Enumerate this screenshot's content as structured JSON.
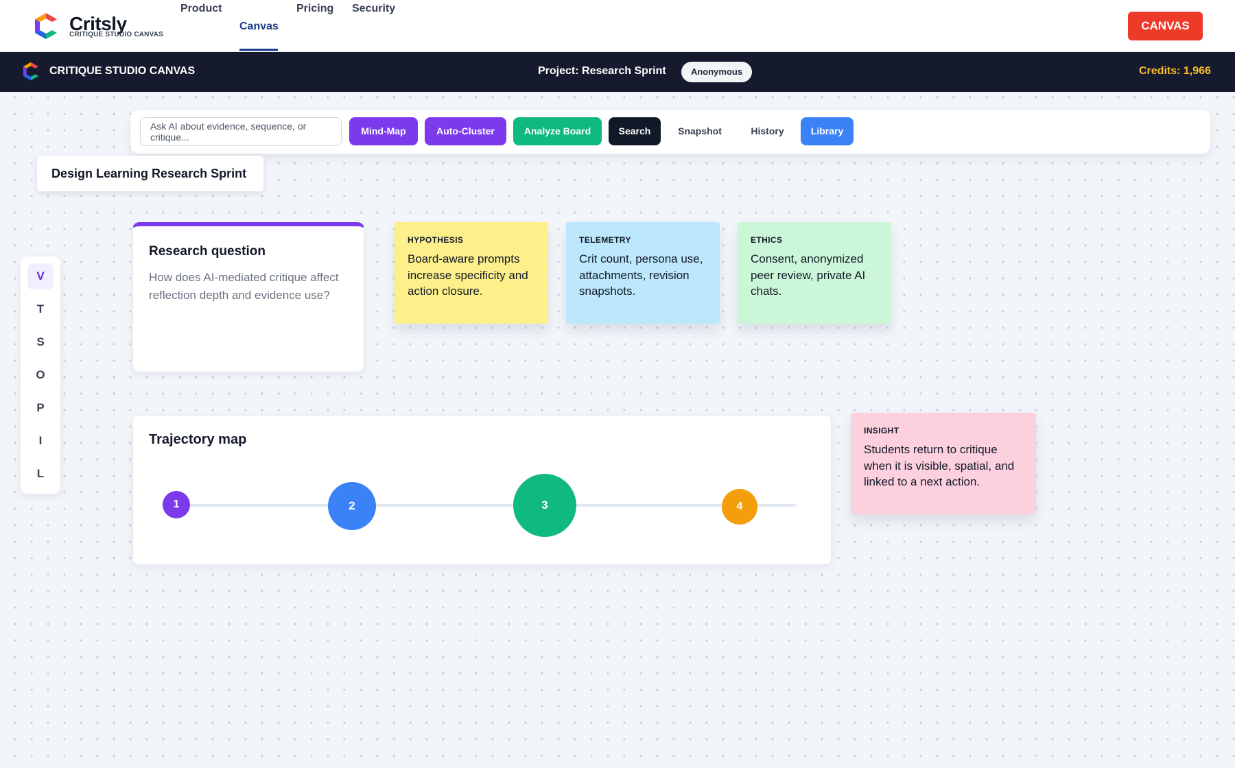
{
  "nav": {
    "brand_name": "Critsly",
    "brand_subtitle": "CRITIQUE STUDIO CANVAS",
    "links": [
      "Product",
      "Canvas",
      "Pricing",
      "Security"
    ],
    "active_link": "Canvas",
    "cta_label": "CANVAS"
  },
  "studio_bar": {
    "title": "CRITIQUE STUDIO CANVAS",
    "project": "Project: Research Sprint",
    "badge": "Anonymous",
    "credits": "Credits: 1,966"
  },
  "toolbar": {
    "ask_placeholder": "Ask AI about evidence, sequence, or critique...",
    "buttons": [
      "Mind-Map",
      "Auto-Cluster",
      "Analyze Board",
      "Search",
      "Snapshot",
      "History",
      "Library"
    ]
  },
  "board": {
    "title": "Design Learning Research Sprint"
  },
  "rail": {
    "items": [
      "V",
      "T",
      "S",
      "O",
      "P",
      "I",
      "L"
    ],
    "active": "V"
  },
  "research_card": {
    "title": "Research question",
    "body": "How does AI-mediated critique affect reflection depth and evidence use?"
  },
  "stickies": [
    {
      "label": "HYPOTHESIS",
      "text": "Board-aware prompts increase specificity and action closure.",
      "color": "#fdf08a"
    },
    {
      "label": "TELEMETRY",
      "text": "Crit count, persona use, attachments, revision snapshots.",
      "color": "#bde7fb"
    },
    {
      "label": "ETHICS",
      "text": "Consent, anonymized peer review, private AI chats.",
      "color": "#cbf7d8"
    },
    {
      "label": "INSIGHT",
      "text": "Students return to critique when it is visible, spatial, and linked to a next action.",
      "color": "#fdd0de"
    }
  ],
  "trajectory": {
    "title": "Trajectory map",
    "nodes": [
      {
        "label": "1",
        "color": "#7c3aed"
      },
      {
        "label": "2",
        "color": "#3b82f6"
      },
      {
        "label": "3",
        "color": "#10b981"
      },
      {
        "label": "4",
        "color": "#f59e0b"
      }
    ]
  },
  "colors": {
    "accent_purple": "#7c3aed",
    "cta_red": "#ee3a28",
    "header_dark": "#161a2e",
    "credits_gold": "#fbbf24",
    "nav_active": "#1e3a8a"
  }
}
